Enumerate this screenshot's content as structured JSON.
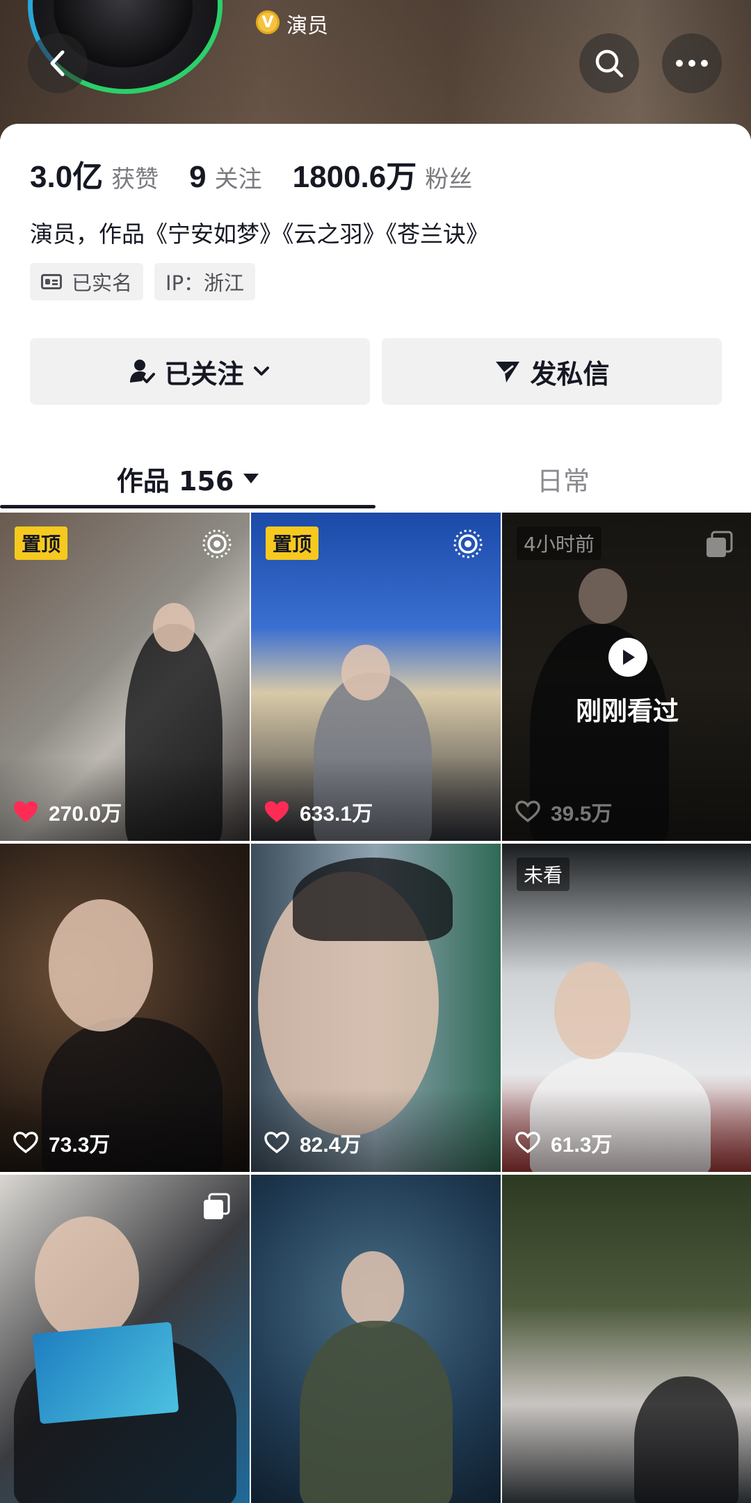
{
  "header": {
    "role": "演员",
    "verified_badge": "V",
    "icons": {
      "back": "back-chevron-icon",
      "search": "search-icon",
      "more": "more-dots-icon"
    }
  },
  "profile": {
    "stats": [
      {
        "value": "3.0亿",
        "label": "获赞"
      },
      {
        "value": "9",
        "label": "关注"
      },
      {
        "value": "1800.6万",
        "label": "粉丝"
      }
    ],
    "bio": "演员，作品《宁安如梦》《云之羽》《苍兰诀》",
    "tags": [
      {
        "label": "已实名",
        "icon": "id-card-icon"
      },
      {
        "label": "IP：浙江"
      }
    ],
    "buttons": {
      "follow": "已关注",
      "message": "发私信"
    }
  },
  "tabs": [
    {
      "label": "作品 156",
      "active": true
    },
    {
      "label": "日常",
      "active": false
    }
  ],
  "videos": [
    {
      "badge": "置顶",
      "likes": "270.0万",
      "liked": true,
      "corner_icon": "live-photo-icon"
    },
    {
      "badge": "置顶",
      "likes": "633.1万",
      "liked": true,
      "corner_icon": "live-photo-icon"
    },
    {
      "badge": "4小时前",
      "likes": "39.5万",
      "liked": false,
      "corner_icon": "multi-image-icon",
      "overlay_text": "刚刚看过"
    },
    {
      "likes": "73.3万",
      "liked": false
    },
    {
      "likes": "82.4万",
      "liked": false
    },
    {
      "badge": "未看",
      "likes": "61.3万",
      "liked": false
    },
    {
      "corner_icon": "multi-image-icon"
    },
    {},
    {}
  ],
  "colors": {
    "pin_badge": "#f7c91f",
    "liked_heart": "#fe2c55",
    "verified": "#f5c23d",
    "avatar_ring": "#2bd06a"
  }
}
